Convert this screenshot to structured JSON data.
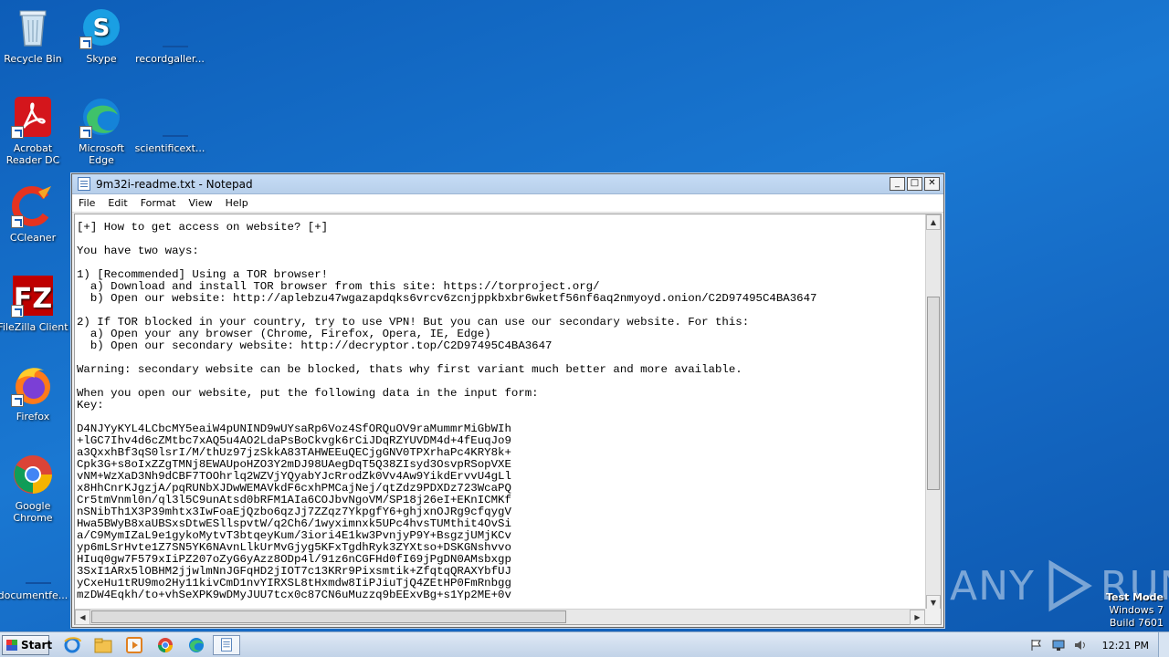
{
  "desktop": {
    "icons": [
      {
        "label": "Recycle Bin"
      },
      {
        "label": "Skype"
      },
      {
        "label": "recordgaller..."
      },
      {
        "label": "Acrobat Reader DC"
      },
      {
        "label": "Microsoft Edge"
      },
      {
        "label": "scientificext..."
      },
      {
        "label": "CCleaner"
      },
      {
        "label": "FileZilla Client"
      },
      {
        "label": "Firefox"
      },
      {
        "label": "Google Chrome"
      },
      {
        "label": "documentfe..."
      }
    ]
  },
  "notepad": {
    "title": "9m32i-readme.txt - Notepad",
    "menu": [
      "File",
      "Edit",
      "Format",
      "View",
      "Help"
    ],
    "lines": [
      "[+] How to get access on website? [+]",
      "",
      "You have two ways:",
      "",
      "1) [Recommended] Using a TOR browser!",
      "  a) Download and install TOR browser from this site: https://torproject.org/",
      "  b) Open our website: http://aplebzu47wgazapdqks6vrcv6zcnjppkbxbr6wketf56nf6aq2nmyoyd.onion/C2D97495C4BA3647",
      "",
      "2) If TOR blocked in your country, try to use VPN! But you can use our secondary website. For this:",
      "  a) Open your any browser (Chrome, Firefox, Opera, IE, Edge)",
      "  b) Open our secondary website: http://decryptor.top/C2D97495C4BA3647",
      "",
      "Warning: secondary website can be blocked, thats why first variant much better and more available.",
      "",
      "When you open our website, put the following data in the input form:",
      "Key:",
      "",
      "D4NJYyKYL4LCbcMY5eaiW4pUNIND9wUYsaRp6Voz4SfORQuOV9raMummrMiGbWIh",
      "+lGC7Ihv4d6cZMtbc7xAQ5u4AO2LdaPsBoCkvgk6rCiJDqRZYUVDM4d+4fEuqJo9",
      "a3QxxhBf3qS0lsrI/M/thUz97jzSkkA83TAHWEEuQECjgGNV0TPXrhaPc4KRY8k+",
      "Cpk3G+s8oIxZZgTMNj8EWAUpoHZO3Y2mDJ98UAegDqT5Q38ZIsyd3OsvpRSopVXE",
      "vNM+WzXaD3Nh9dCBF7TOOhrlq2WZVjYQyabYJcRrodZk0Vv4Aw9YikdErvvU4gLl",
      "x8HhCnrKJgzjA/pqRUNbXJDwWEMAVkdF6cxhPMCajNej/qtZdz9PDXDz723WcaPQ",
      "Cr5tmVnml0n/ql3l5C9unAtsd0bRFM1AIa6COJbvNgoVM/SP18j26eI+EKnICMKf",
      "nSNibTh1X3P39mhtx3IwFoaEjQzbo6qzJj7ZZqz7YkpgfY6+ghjxnOJRg9cfqygV",
      "Hwa5BWyB8xaUBSxsDtwESllspvtW/q2Ch6/1wyximnxk5UPc4hvsTUMthit4OvSi",
      "a/C9MymIZaL9e1gykoMytvT3btqeyKum/3iori4E1kw3PvnjyP9Y+BsgzjUMjKCv",
      "yp6mLSrHvte1Z7SN5YK6NAvnLlkUrMvGjyg5KFxTgdhRyk3ZYXtso+DSKGNshvvo",
      "HIuq0gw7F579xIiPZ207oZyG6yAzz8ODp4l/91z6nCGFHd0fI69jPgDN0AMsbxgp",
      "3SxI1ARx5lOBHM2jjwlmNnJGFqHD2jIOT7c13KRr9Pixsmtik+ZfqtqQRAXYbfUJ",
      "yCxeHu1tRU9mo2Hy11kivCmD1nvYIRXSL8tHxmdw8IiPJiuTjQ4ZEtHP0FmRnbgg",
      "mzDW4Eqkh/to+vhSeXPK9wDMyJUU7tcx0c87CN6uMuzzq9bEExvBg+s1Yp2ME+0v"
    ]
  },
  "watermark": {
    "text_left": "ANY",
    "text_right": "RUN"
  },
  "test_mode": {
    "line1": "Test Mode",
    "line2": "Windows 7",
    "line3": "Build 7601"
  },
  "taskbar": {
    "start_label": "Start",
    "clock": "12:21 PM"
  }
}
